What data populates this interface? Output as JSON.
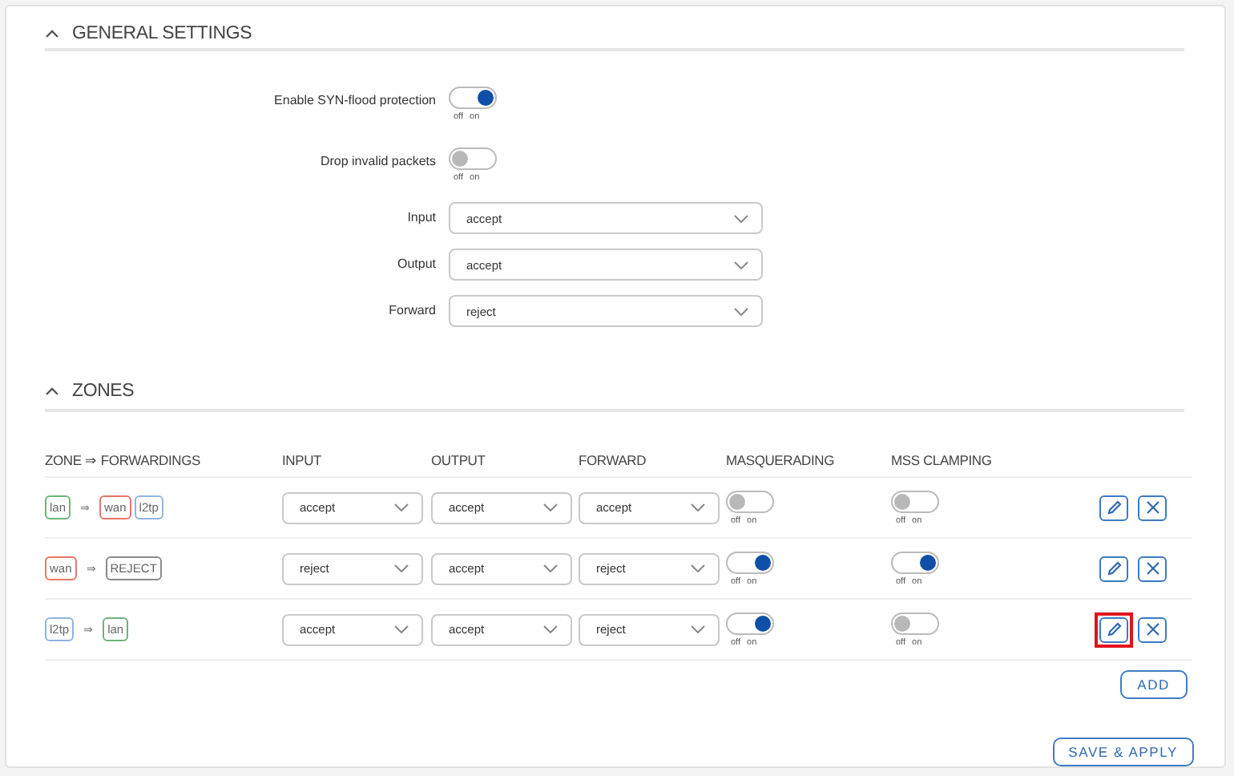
{
  "general_settings": {
    "title": "GENERAL SETTINGS",
    "expanded": true,
    "toggles": [
      {
        "label": "Enable SYN-flood protection",
        "on": true,
        "off_label": "off",
        "on_label": "on"
      },
      {
        "label": "Drop invalid packets",
        "on": false,
        "off_label": "off",
        "on_label": "on"
      }
    ],
    "selects": [
      {
        "label": "Input",
        "value": "accept"
      },
      {
        "label": "Output",
        "value": "accept"
      },
      {
        "label": "Forward",
        "value": "reject"
      }
    ]
  },
  "zones": {
    "title": "ZONES",
    "expanded": true,
    "columns": [
      "ZONE ⇒ FORWARDINGS",
      "INPUT",
      "OUTPUT",
      "FORWARD",
      "MASQUERADING",
      "MSS CLAMPING"
    ],
    "rows": [
      {
        "zone": {
          "name": "lan",
          "color": "#6cb47a"
        },
        "arrow": "⇒",
        "forwardings": [
          {
            "name": "wan",
            "color": "#e8776c"
          },
          {
            "name": "l2tp",
            "color": "#8fb5e0"
          }
        ],
        "input": "accept",
        "output": "accept",
        "forward": "accept",
        "masquerading": false,
        "mss_clamping": false,
        "toggle_labels": {
          "masquerading_off": "off",
          "masquerading_on": "on",
          "mss_off": "off",
          "mss_on": "on"
        },
        "edit_highlighted": false
      },
      {
        "zone": {
          "name": "wan",
          "color": "#e8776c"
        },
        "arrow": "⇒",
        "forwardings": [
          {
            "name": "REJECT",
            "color": "#8a8a8a"
          }
        ],
        "input": "reject",
        "output": "accept",
        "forward": "reject",
        "masquerading": true,
        "mss_clamping": true,
        "toggle_labels": {
          "masquerading_off": "off",
          "masquerading_on": "on",
          "mss_off": "off",
          "mss_on": "on"
        },
        "edit_highlighted": false
      },
      {
        "zone": {
          "name": "l2tp",
          "color": "#8fb5e0"
        },
        "arrow": "⇒",
        "forwardings": [
          {
            "name": "lan",
            "color": "#6cb47a"
          }
        ],
        "input": "accept",
        "output": "accept",
        "forward": "reject",
        "masquerading": true,
        "mss_clamping": false,
        "toggle_labels": {
          "masquerading_off": "off",
          "masquerading_on": "on",
          "mss_off": "off",
          "mss_on": "on"
        },
        "edit_highlighted": true
      }
    ],
    "add_button": "ADD"
  },
  "save_button": "SAVE & APPLY"
}
